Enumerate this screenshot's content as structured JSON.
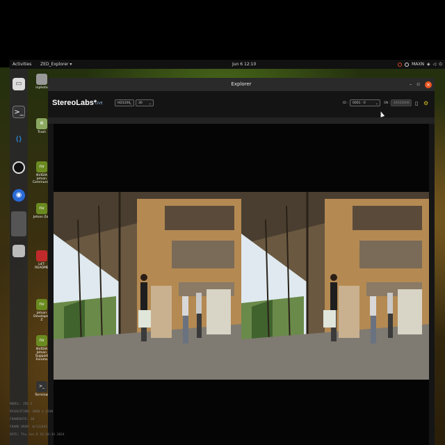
{
  "desktop": {
    "topbar": {
      "activities": "Activities",
      "app_menu": "ZED_Explorer ▾",
      "clock": "Jun 6 12:10",
      "tray_label": "MAXN"
    },
    "desktop_icons": [
      {
        "label": "inphoto",
        "icon": "folder-icon"
      },
      {
        "label": "Trash",
        "icon": "trash-icon"
      },
      {
        "label": "NVIDIA Jetson Community",
        "icon": "nvidia-icon"
      },
      {
        "label": "Jetson Zoo",
        "icon": "nvidia-icon"
      },
      {
        "label": "L4T-README",
        "icon": "folder-icon"
      },
      {
        "label": "Jetson Developer Z",
        "icon": "nvidia-icon"
      },
      {
        "label": "NVIDIA Jetson Support Forums",
        "icon": "nvidia-icon"
      },
      {
        "label": "Terminal",
        "icon": "terminal-icon"
      }
    ]
  },
  "window": {
    "title": "Explorer",
    "brand": "StereoLabs*",
    "live_label": "LIVE",
    "resolution_select": "HD1200",
    "fps_select": "30",
    "id_label": "ID :",
    "device_select": "0001 - 0",
    "sn_label": "SN :",
    "sn_value": "44020006"
  },
  "stream_info": {
    "model": "MODEL: ZED X",
    "resolution": "RESOLUTION: 3840 x 1200",
    "framerate": "FRAMERATE: 30",
    "frame_drop": "FRAME DROP: 0/123441",
    "date": "DATE: Thu Jun 6 12:10:34 2024"
  },
  "colors": {
    "accent": "#e95420",
    "topbar": "#111111",
    "window_bg": "#151515"
  }
}
